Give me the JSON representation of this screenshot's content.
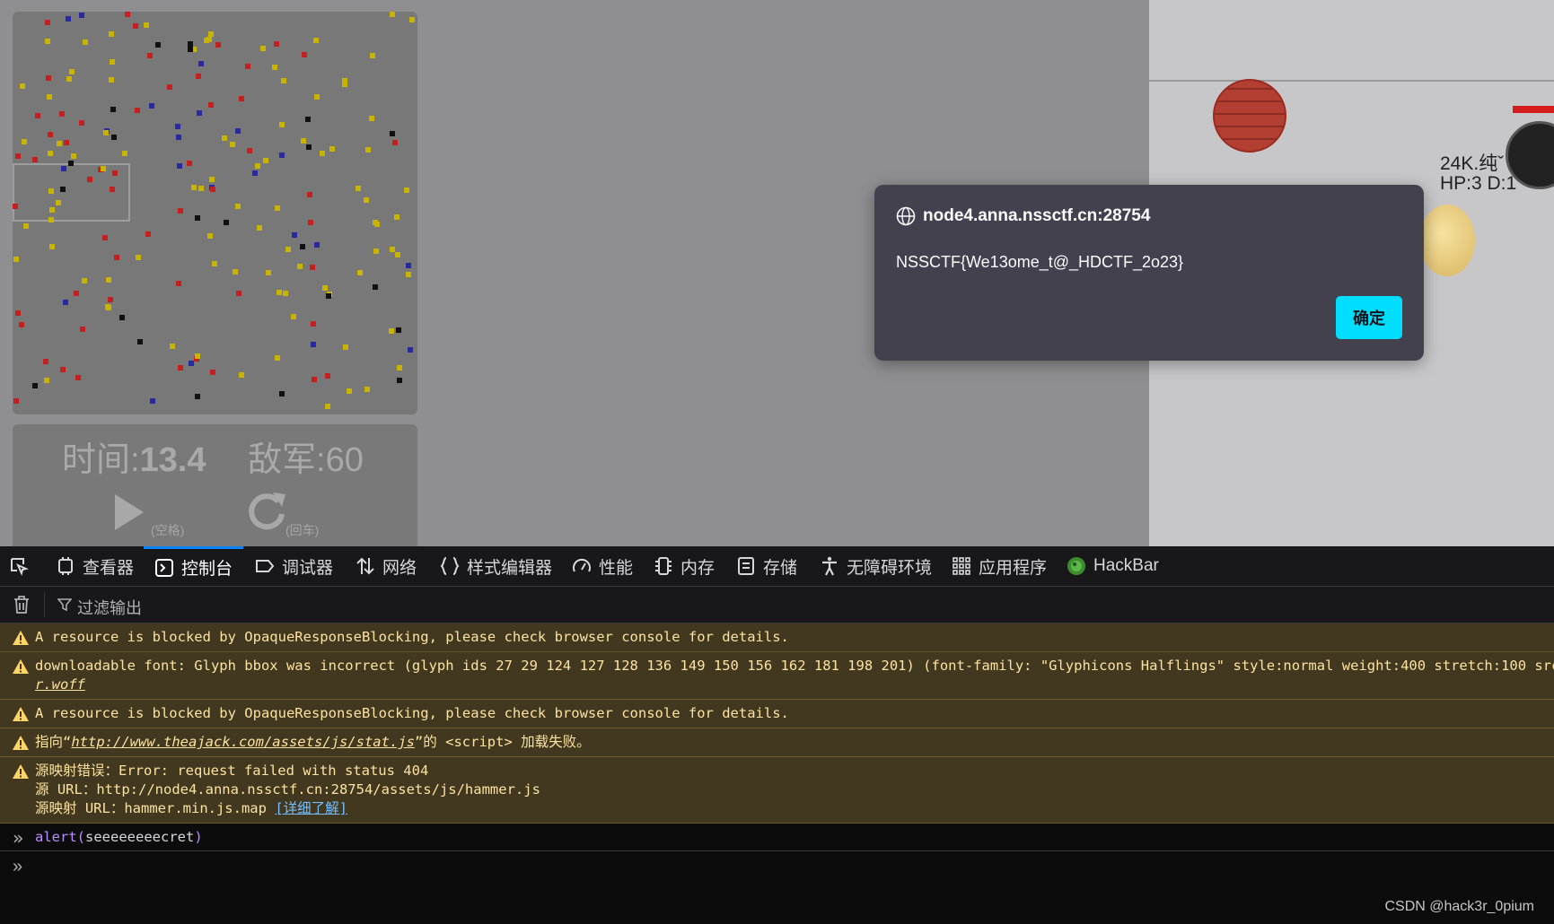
{
  "hud": {
    "time_label": "时间:",
    "time_value": "13.4",
    "enemy_label": "敌军:",
    "enemy_value": "60",
    "play_hint": "(空格)",
    "restart_hint": "(回车)"
  },
  "game": {
    "player_name": "24K.纯ˇ",
    "player_stats": "HP:3 D:1"
  },
  "dialog": {
    "host": "node4.anna.nssctf.cn:28754",
    "message": "NSSCTF{We13ome_t@_HDCTF_2o23}",
    "ok_label": "确定"
  },
  "devtools": {
    "tabs": [
      {
        "label": "查看器",
        "icon": "inspector-icon"
      },
      {
        "label": "控制台",
        "icon": "console-icon"
      },
      {
        "label": "调试器",
        "icon": "debugger-icon"
      },
      {
        "label": "网络",
        "icon": "network-icon"
      },
      {
        "label": "样式编辑器",
        "icon": "style-editor-icon"
      },
      {
        "label": "性能",
        "icon": "performance-icon"
      },
      {
        "label": "内存",
        "icon": "memory-icon"
      },
      {
        "label": "存储",
        "icon": "storage-icon"
      },
      {
        "label": "无障碍环境",
        "icon": "accessibility-icon"
      },
      {
        "label": "应用程序",
        "icon": "application-icon"
      },
      {
        "label": "HackBar",
        "icon": "hackbar-icon"
      }
    ],
    "active_tab": "控制台",
    "filter_placeholder": "过滤输出",
    "messages": {
      "m1": "A resource is blocked by OpaqueResponseBlocking, please check browser console for details.",
      "m2_line1": "downloadable font: Glyph bbox was incorrect (glyph ids 27 29 124 127 128 136 149 150 156 162 181 198 201) (font-family: \"Glyphicons Halflings\" style:normal weight:400 stretch:100 src inde",
      "m2_line2": "r.woff",
      "m3": "A resource is blocked by OpaqueResponseBlocking, please check browser console for details.",
      "m4_pre": "指向“",
      "m4_link": "http://www.theajack.com/assets/js/stat.js",
      "m4_post": "”的 <script> 加载失败。",
      "m5_line1": "源映射错误：Error: request failed with status 404",
      "m5_line2": "源 URL：http://node4.anna.nssctf.cn:28754/assets/js/hammer.js",
      "m5_line3_pre": "源映射 URL：hammer.min.js.map ",
      "m5_learn": "[详细了解]"
    },
    "input_fn": "alert(",
    "input_arg": "seeeeeeeecret",
    "input_close": ")"
  },
  "watermark": "CSDN @hack3r_0pium",
  "colors": {
    "accent": "#00ddff",
    "tab_active": "#0a84ff",
    "warning_bg": "#42381f",
    "warning_text": "#fce2a1"
  }
}
